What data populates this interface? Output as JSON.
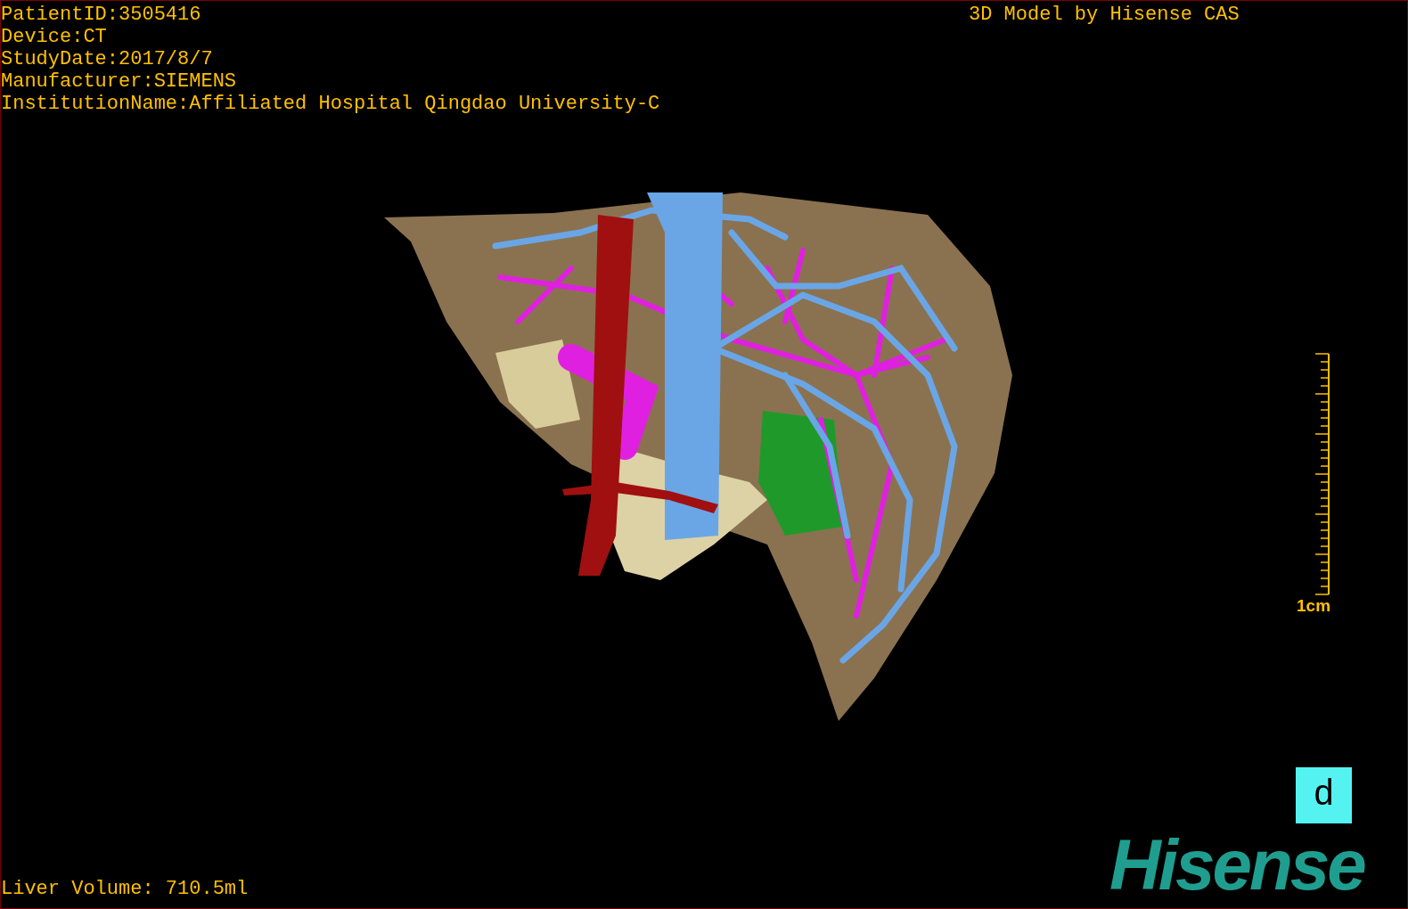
{
  "patient_info": [
    "PatientID:3505416",
    "Device:CT",
    "StudyDate:2017/8/7",
    "Manufacturer:SIEMENS",
    "InstitutionName:Affiliated Hospital Qingdao University-C"
  ],
  "model_credit": "3D Model by Hisense CAS",
  "scale_bar": {
    "label": "1cm"
  },
  "orientation_cube": {
    "label": "d"
  },
  "liver_volume": "Liver Volume: 710.5ml",
  "logo": "Hisense"
}
